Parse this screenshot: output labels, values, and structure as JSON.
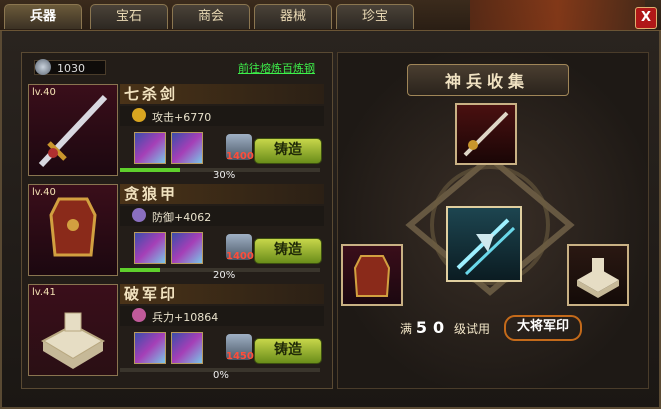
{
  "tabs": [
    {
      "label": "兵器",
      "active": true
    },
    {
      "label": "宝石",
      "active": false
    },
    {
      "label": "商会",
      "active": false
    },
    {
      "label": "器械",
      "active": false
    },
    {
      "label": "珍宝",
      "active": false
    }
  ],
  "close_label": "X",
  "currency": {
    "value": "1030",
    "icon": "silver-coin-icon"
  },
  "refine_link": "前往熔炼百炼钢",
  "items": [
    {
      "level": "lv.40",
      "name": "七杀剑",
      "stat": "攻击+6770",
      "cost": "1400",
      "forge_label": "铸造",
      "progress_pct": 30,
      "progress_label": "30%",
      "stat_color": "#d8a520"
    },
    {
      "level": "lv.40",
      "name": "贪狼甲",
      "stat": "防御+4062",
      "cost": "1400",
      "forge_label": "铸造",
      "progress_pct": 20,
      "progress_label": "20%",
      "stat_color": "#8a6fc0"
    },
    {
      "level": "lv.41",
      "name": "破军印",
      "stat": "兵力+10864",
      "cost": "1450",
      "forge_label": "铸造",
      "progress_pct": 0,
      "progress_label": "0%",
      "stat_color": "#c05a9a"
    }
  ],
  "collection": {
    "title": "神兵收集",
    "hint_prefix": "满",
    "hint_level": "50",
    "hint_suffix": "级试用",
    "seal_label": "大将军印"
  },
  "colors": {
    "accent_green": "#3df04a",
    "cost_red": "#ff4d3a",
    "forge_green": "#9fbf2e"
  }
}
